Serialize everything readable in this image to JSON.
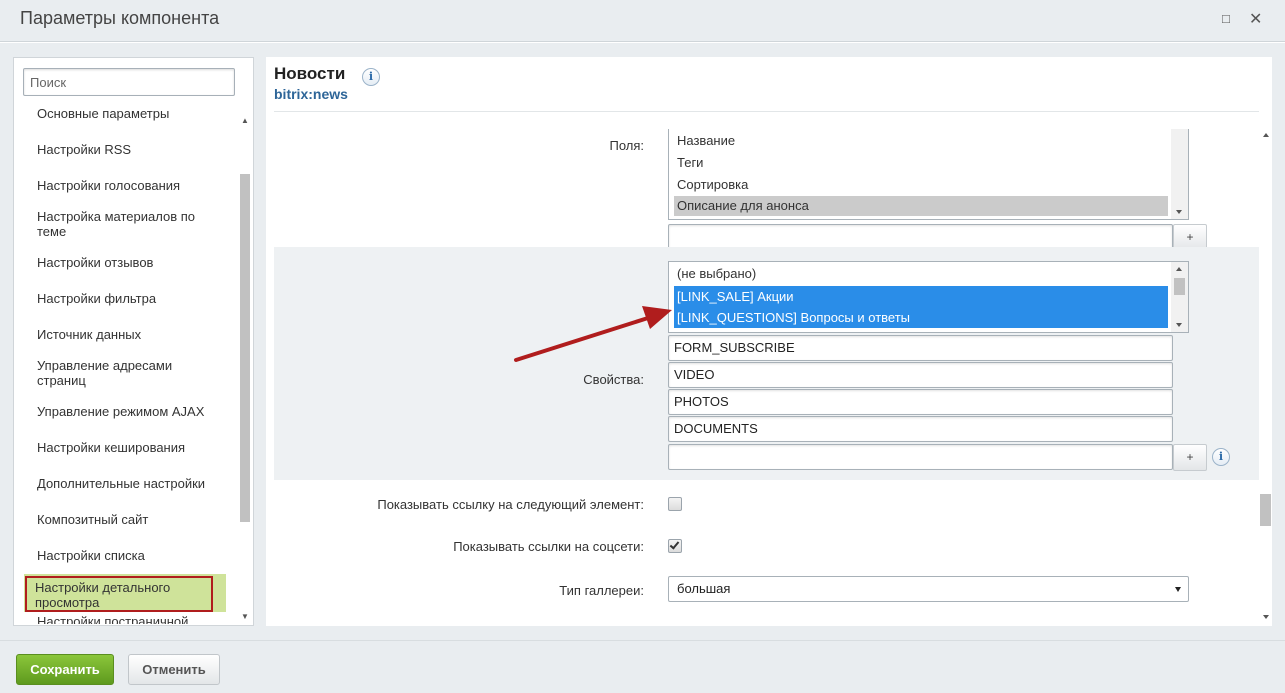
{
  "window": {
    "title": "Параметры компонента",
    "maximize_icon": "□",
    "close_icon": "✕"
  },
  "sidebar": {
    "search_placeholder": "Поиск",
    "items": [
      {
        "label": "Основные параметры"
      },
      {
        "label": "Настройки RSS"
      },
      {
        "label": "Настройки голосования"
      },
      {
        "label": "Настройка материалов по теме"
      },
      {
        "label": "Настройки отзывов"
      },
      {
        "label": "Настройки фильтра"
      },
      {
        "label": "Источник данных"
      },
      {
        "label": "Управление адресами страниц"
      },
      {
        "label": "Управление режимом AJAX"
      },
      {
        "label": "Настройки кеширования"
      },
      {
        "label": "Дополнительные настройки"
      },
      {
        "label": "Композитный сайт"
      },
      {
        "label": "Настройки списка"
      },
      {
        "label": "Настройки детального просмотра",
        "active": true
      },
      {
        "label": "Настройки постраничной"
      }
    ]
  },
  "component": {
    "name": "Новости",
    "code": "bitrix:news",
    "info_icon": "i"
  },
  "fields": {
    "label": "Поля:",
    "options": [
      "Название",
      "Теги",
      "Сортировка",
      "Описание для анонса"
    ],
    "selected": "Описание для анонса",
    "extra_value": "",
    "add_label": "+"
  },
  "properties": {
    "label": "Свойства:",
    "options": [
      "(не выбрано)",
      "[LINK_SALE] Акции",
      "[LINK_QUESTIONS] Вопросы и ответы"
    ],
    "selected": [
      "[LINK_SALE] Акции",
      "[LINK_QUESTIONS] Вопросы и ответы"
    ],
    "inputs": [
      "FORM_SUBSCRIBE",
      "VIDEO",
      "PHOTOS",
      "DOCUMENTS",
      ""
    ],
    "add_label": "+",
    "info_icon": "i"
  },
  "show_next_link": {
    "label": "Показывать ссылку на следующий элемент:",
    "checked": false
  },
  "show_social_links": {
    "label": "Показывать ссылки на соцсети:",
    "checked": true
  },
  "gallery_type": {
    "label": "Тип галлереи:",
    "value": "большая"
  },
  "footer": {
    "save_label": "Сохранить",
    "cancel_label": "Отменить"
  },
  "colors": {
    "selection_blue": "#2a8de8",
    "active_nav_bg": "#cfe39a",
    "highlight_border": "#b01d1d",
    "arrow": "#b01d1d",
    "save_button": "#6aa92a"
  },
  "annotation": {
    "type": "red-arrow",
    "points_to": "[LINK_SALE] Акции"
  }
}
